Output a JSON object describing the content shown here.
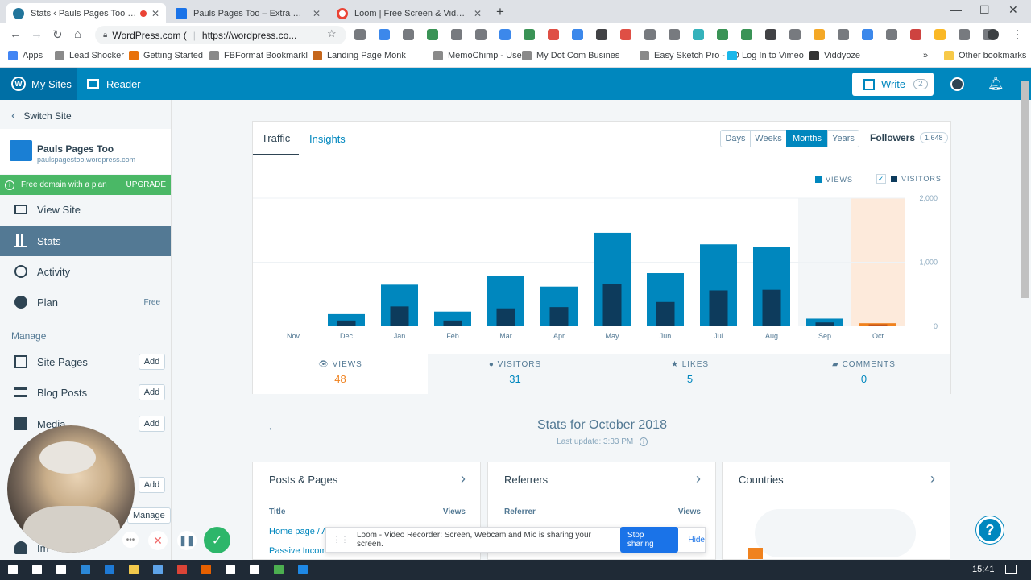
{
  "browser": {
    "tabs": [
      {
        "title": "Stats ‹ Pauls Pages Too — W",
        "favicon_color": "#21759b",
        "active": true
      },
      {
        "title": "Pauls Pages Too – Extra Content",
        "favicon_color": "#1a73e8",
        "active": false
      },
      {
        "title": "Loom | Free Screen & Video Rec",
        "favicon_color": "#ea4335",
        "active": false
      }
    ],
    "url_site": "WordPress.com (",
    "url": "https://wordpress.co...",
    "bookmarks": [
      "Apps",
      "Lead Shocker",
      "Getting Started",
      "FBFormat Bookmarkl",
      "Landing Page Monk",
      "MemoChimp - User",
      "My Dot Com Busines",
      "Easy Sketch Pro - LO",
      "Log In to Vimeo",
      "Viddyoze"
    ],
    "other_bookmarks": "Other bookmarks"
  },
  "masterbar": {
    "my_sites": "My Sites",
    "reader": "Reader",
    "write": "Write",
    "write_count": "2"
  },
  "sidebar": {
    "switch_site": "Switch Site",
    "site_name": "Pauls Pages Too",
    "site_url": "paulspagestoo.wordpress.com",
    "banner": "Free domain with a plan",
    "banner_action": "UPGRADE",
    "items": [
      {
        "label": "View Site"
      },
      {
        "label": "Stats"
      },
      {
        "label": "Activity"
      },
      {
        "label": "Plan",
        "badge": "Free"
      }
    ],
    "manage_heading": "Manage",
    "manage_items": [
      {
        "label": "Site Pages",
        "action": "Add"
      },
      {
        "label": "Blog Posts",
        "action": "Add"
      },
      {
        "label": "Media",
        "action": "Add"
      },
      {
        "label": "",
        "action": "Add"
      }
    ],
    "manage_link": "Manage",
    "import_label": "Im"
  },
  "stats": {
    "tabs": [
      "Traffic",
      "Insights"
    ],
    "periods": [
      "Days",
      "Weeks",
      "Months",
      "Years"
    ],
    "active_period": "Months",
    "followers_label": "Followers",
    "followers_count": "1,648",
    "legend_views": "VIEWS",
    "legend_visitors": "VISITORS",
    "summary": [
      {
        "label": "VIEWS",
        "value": "48"
      },
      {
        "label": "VISITORS",
        "value": "31"
      },
      {
        "label": "LIKES",
        "value": "5"
      },
      {
        "label": "COMMENTS",
        "value": "0"
      }
    ],
    "period_title": "Stats for October 2018",
    "last_update": "Last update: 3:33 PM",
    "cards": [
      {
        "title": "Posts & Pages",
        "col1": "Title",
        "col2": "Views",
        "rows": [
          "Home page / Ar",
          "Passive Income"
        ]
      },
      {
        "title": "Referrers",
        "col1": "Referrer",
        "col2": "Views",
        "rows": []
      },
      {
        "title": "Countries",
        "col1": "",
        "col2": "",
        "rows": []
      }
    ]
  },
  "chart_data": {
    "type": "bar",
    "categories": [
      "Nov",
      "Dec",
      "Jan",
      "Feb",
      "Mar",
      "Apr",
      "May",
      "Jun",
      "Jul",
      "Aug",
      "Sep",
      "Oct"
    ],
    "series": [
      {
        "name": "VIEWS",
        "values": [
          0,
          190,
          650,
          230,
          780,
          620,
          1460,
          830,
          1280,
          1240,
          120,
          48
        ]
      },
      {
        "name": "VISITORS",
        "values": [
          0,
          90,
          310,
          90,
          280,
          300,
          660,
          380,
          560,
          570,
          60,
          31
        ]
      }
    ],
    "ylim": [
      0,
      2000
    ],
    "yticks": [
      "0",
      "1,000",
      "2,000"
    ],
    "colors": {
      "views": "#0087be",
      "visitors": "#0d3b5c",
      "current_views": "#f0821e",
      "current_visitors": "#c6551a"
    }
  },
  "loom": {
    "notice": "Loom - Video Recorder: Screen, Webcam and Mic is sharing your screen.",
    "stop": "Stop sharing",
    "hide": "Hide"
  },
  "taskbar": {
    "time": "15:41"
  }
}
